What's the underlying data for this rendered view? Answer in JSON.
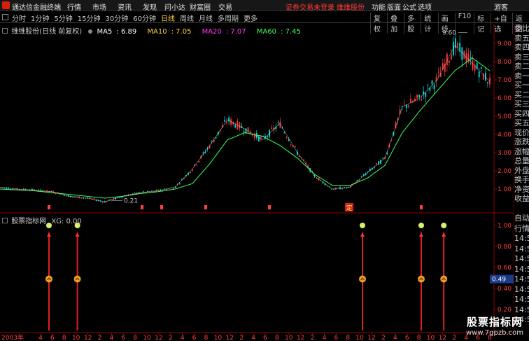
{
  "app": {
    "title": "通达信金融终端"
  },
  "menu": [
    "行情",
    "市场",
    "资讯",
    "发现",
    "问小达",
    "财富圈",
    "交易"
  ],
  "notice": "证券交易未登录   维维股份",
  "right_menu": [
    "功能",
    "版面",
    "公式",
    "选项"
  ],
  "guest": "游客",
  "periods": [
    "分时",
    "1分钟",
    "5分钟",
    "15分钟",
    "30分钟",
    "60分钟",
    "日线",
    "周线",
    "月线",
    "多周期",
    "更多"
  ],
  "active_period": "日线",
  "func_buttons": [
    "复权",
    "叠加",
    "多股",
    "统计",
    "画线",
    "F10",
    "标记",
    "+自选",
    "返回"
  ],
  "main_chart": {
    "stock_label": "维维股份(日线 前复权)",
    "ma": [
      {
        "name": "MA5",
        "value": "6.89",
        "color": "#ffffff"
      },
      {
        "name": "MA10",
        "value": "7.05",
        "color": "#ffd23a"
      },
      {
        "name": "MA20",
        "value": "7.07",
        "color": "#ff3cf0"
      },
      {
        "name": "MA60",
        "value": "7.45",
        "color": "#3cff5a"
      }
    ],
    "y_ticks": [
      "9.00",
      "8.00",
      "7.00",
      "6.00",
      "5.00",
      "4.00",
      "3.00",
      "2.00",
      "1.00"
    ],
    "high_label": "9.60",
    "low_label": "0.21",
    "marker_ding": "定"
  },
  "indicator": {
    "label": "股票指标网",
    "value_label": "XG: 0.00",
    "y_ticks": [
      "1.00",
      "0.80",
      "0.60",
      "0.40",
      "0.20"
    ],
    "current_value": "0.49"
  },
  "x_axis": {
    "first_label": "2003年",
    "labels": [
      "4",
      "6",
      "8",
      "10",
      "12",
      "2",
      "4",
      "6",
      "8",
      "10",
      "12",
      "2",
      "4",
      "6",
      "8",
      "10",
      "12",
      "2",
      "4",
      "6",
      "8",
      "10",
      "12",
      "2",
      "4",
      "6",
      "8",
      "10",
      "12",
      "2",
      "4",
      "6",
      "8",
      "10",
      "12",
      "2",
      "4",
      "6",
      "8"
    ]
  },
  "quote_panel": [
    "委比",
    "卖五",
    "卖四",
    "卖三",
    "卖二",
    "卖一",
    "买一",
    "买二",
    "买三",
    "买四",
    "买五",
    "现价",
    "涨跌",
    "涨幅",
    "总量",
    "外盘",
    "换手",
    "净资",
    "收益"
  ],
  "tick_panel": [
    "自动",
    "行情",
    "14:50",
    "14:50",
    "14:50",
    "14:50",
    "14:50",
    "14:50",
    "14:50",
    "14:50",
    "14:50"
  ],
  "watermark": {
    "main": "股票指标网",
    "url": "www.7gpzb.com"
  },
  "chart_data": {
    "type": "line",
    "x_labels": [
      "2003年"
    ],
    "series": [
      {
        "name": "MA60",
        "values": [
          1.0,
          0.95,
          0.9,
          0.8,
          0.7,
          0.6,
          0.5,
          0.6,
          0.75,
          0.85,
          1.0,
          1.3,
          2.4,
          3.7,
          4.1,
          3.9,
          3.4,
          2.7,
          1.8,
          1.2,
          1.2,
          1.6,
          2.3,
          4.1,
          5.3,
          6.4,
          7.5,
          8.2,
          7.5
        ]
      },
      {
        "name": "MA5",
        "values": [
          1.1,
          1.0,
          0.95,
          0.85,
          0.6,
          0.5,
          0.3,
          0.6,
          0.8,
          0.9,
          1.1,
          2.1,
          3.4,
          4.8,
          4.3,
          3.7,
          4.6,
          3.0,
          1.7,
          1.0,
          1.1,
          1.9,
          2.7,
          5.5,
          6.0,
          7.0,
          8.9,
          7.9,
          6.9
        ]
      }
    ],
    "price_ylim": [
      0,
      10
    ],
    "signal_positions": [
      0.1,
      0.158,
      0.74,
      0.86,
      0.906
    ],
    "signal_ylim": [
      0,
      1.0
    ],
    "grid": false
  }
}
